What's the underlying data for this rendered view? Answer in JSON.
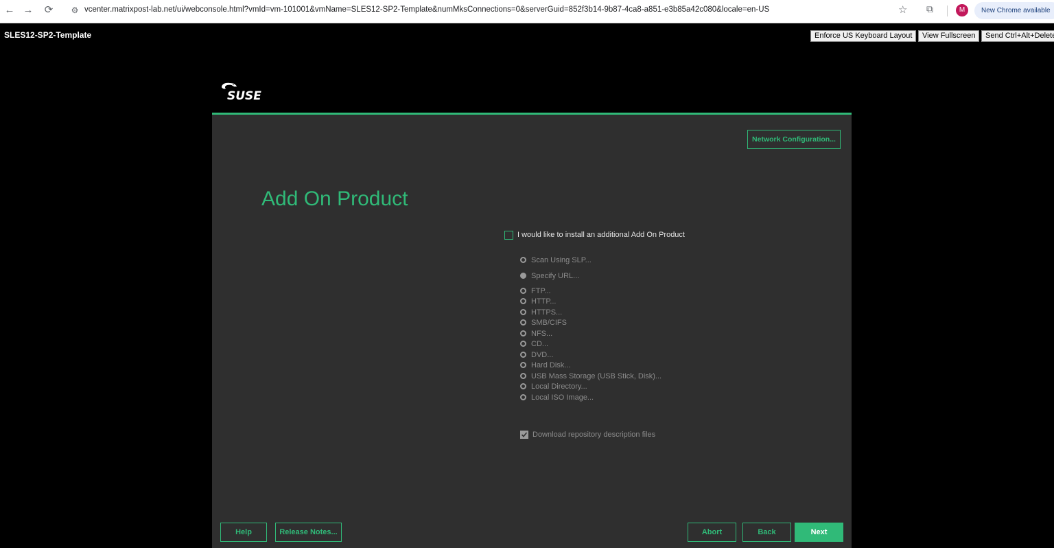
{
  "browser": {
    "url": "vcenter.matrixpost-lab.net/ui/webconsole.html?vmId=vm-101001&vmName=SLES12-SP2-Template&numMksConnections=0&serverGuid=852f3b14-9b87-4ca8-a851-e3b85a42c080&locale=en-US",
    "avatar_letter": "M",
    "update_label": "New Chrome available"
  },
  "console": {
    "vm_name": "SLES12-SP2-Template",
    "buttons": [
      "Enforce US Keyboard Layout",
      "View Fullscreen",
      "Send Ctrl+Alt+Delete"
    ]
  },
  "installer": {
    "logo_text": "SUSE",
    "network_button": "Network Configuration...",
    "title": "Add On Product",
    "main_checkbox_label": "I would like to install an additional Add On Product",
    "main_checkbox_checked": false,
    "options_top": [
      {
        "label": "Scan Using SLP...",
        "selected": false
      },
      {
        "label": "Specify URL...",
        "selected": true
      }
    ],
    "options_list": [
      {
        "label": "FTP...",
        "selected": false
      },
      {
        "label": "HTTP...",
        "selected": false
      },
      {
        "label": "HTTPS...",
        "selected": false
      },
      {
        "label": "SMB/CIFS",
        "selected": false
      },
      {
        "label": "NFS...",
        "selected": false
      },
      {
        "label": "CD...",
        "selected": false
      },
      {
        "label": "DVD...",
        "selected": false
      },
      {
        "label": "Hard Disk...",
        "selected": false
      },
      {
        "label": "USB Mass Storage (USB Stick, Disk)...",
        "selected": false
      },
      {
        "label": "Local Directory...",
        "selected": false
      },
      {
        "label": "Local ISO Image...",
        "selected": false
      }
    ],
    "download_label": "Download repository description files",
    "download_checked": true,
    "footer": {
      "help": "Help",
      "release_notes": "Release Notes...",
      "abort": "Abort",
      "back": "Back",
      "next": "Next"
    }
  },
  "colors": {
    "accent": "#30ba78",
    "panel": "#2f2f2f",
    "background": "#000000"
  }
}
